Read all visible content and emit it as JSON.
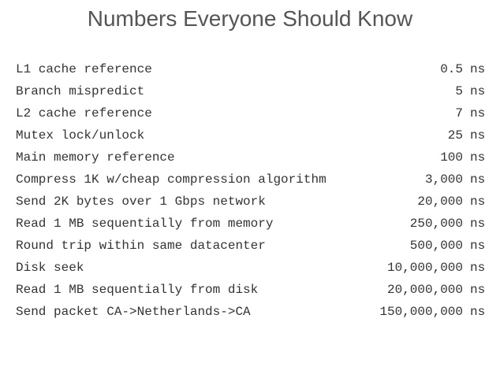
{
  "title": "Numbers Everyone Should Know",
  "rows": [
    {
      "label": "L1 cache reference",
      "value": "0.5",
      "unit": "ns"
    },
    {
      "label": "Branch mispredict",
      "value": "5",
      "unit": "ns"
    },
    {
      "label": "L2 cache reference",
      "value": "7",
      "unit": "ns"
    },
    {
      "label": "Mutex lock/unlock",
      "value": "25",
      "unit": "ns"
    },
    {
      "label": "Main memory reference",
      "value": "100",
      "unit": "ns"
    },
    {
      "label": "Compress 1K w/cheap compression algorithm",
      "value": "3,000",
      "unit": "ns"
    },
    {
      "label": "Send 2K bytes over 1 Gbps network",
      "value": "20,000",
      "unit": "ns"
    },
    {
      "label": "Read 1 MB sequentially from memory",
      "value": "250,000",
      "unit": "ns"
    },
    {
      "label": "Round trip within same datacenter",
      "value": "500,000",
      "unit": "ns"
    },
    {
      "label": "Disk seek",
      "value": "10,000,000",
      "unit": "ns"
    },
    {
      "label": "Read 1 MB sequentially from disk",
      "value": "20,000,000",
      "unit": "ns"
    },
    {
      "label": "Send packet CA->Netherlands->CA",
      "value": "150,000,000",
      "unit": "ns"
    }
  ]
}
